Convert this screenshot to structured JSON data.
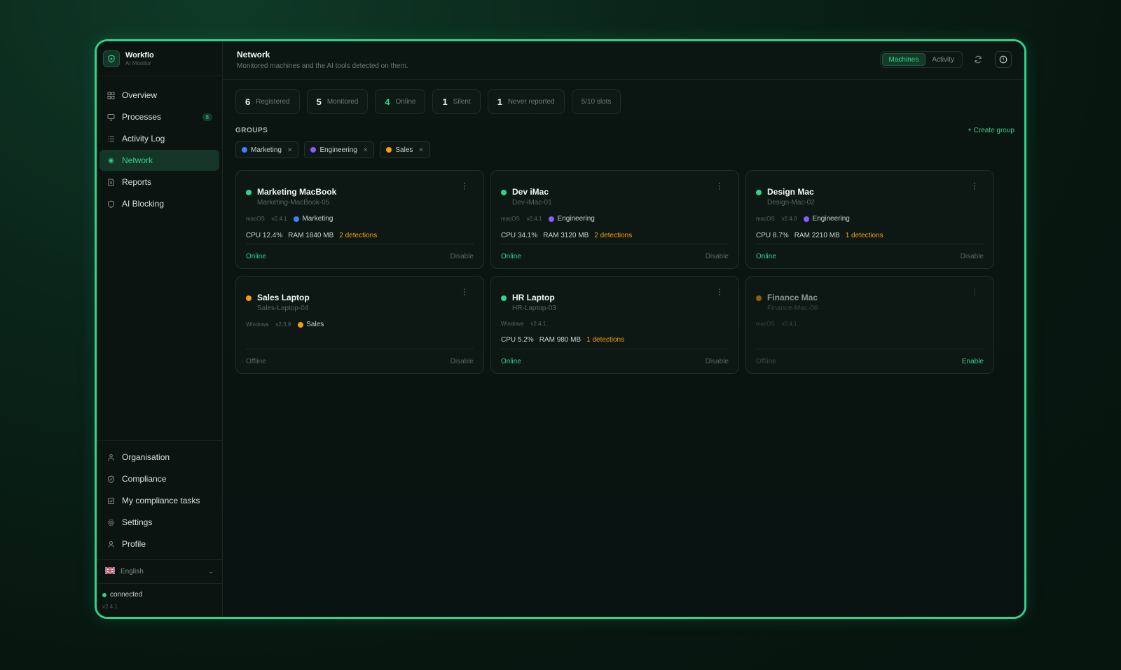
{
  "brand": {
    "name": "Workflo",
    "subtitle": "AI Monitor"
  },
  "sidebar": {
    "items": [
      {
        "label": "Overview",
        "icon": "grid-icon"
      },
      {
        "label": "Processes",
        "icon": "monitor-icon",
        "badge": "8"
      },
      {
        "label": "Activity Log",
        "icon": "list-icon"
      },
      {
        "label": "Network",
        "icon": "network-icon",
        "active": true
      },
      {
        "label": "Reports",
        "icon": "file-icon"
      },
      {
        "label": "AI Blocking",
        "icon": "shield-icon"
      }
    ],
    "bottom_items": [
      {
        "label": "Organisation",
        "icon": "org-icon"
      },
      {
        "label": "Compliance",
        "icon": "shield-check-icon"
      },
      {
        "label": "My compliance tasks",
        "icon": "tasks-icon"
      },
      {
        "label": "Settings",
        "icon": "gear-icon"
      },
      {
        "label": "Profile",
        "icon": "user-icon"
      }
    ],
    "language": "English",
    "connection": {
      "status": "connected",
      "version": "v2.4.1"
    }
  },
  "header": {
    "title": "Network",
    "subtitle": "Monitored machines and the AI tools detected on them.",
    "tabs": [
      "Machines",
      "Activity"
    ],
    "active_tab": "Machines"
  },
  "stats": [
    {
      "value": "6",
      "label": "Registered"
    },
    {
      "value": "5",
      "label": "Monitored"
    },
    {
      "value": "4",
      "label": "Online"
    },
    {
      "value": "1",
      "label": "Silent"
    },
    {
      "value": "1",
      "label": "Never reported"
    },
    {
      "value": "",
      "label": "5/10 slots"
    }
  ],
  "groups": {
    "label": "GROUPS",
    "create_label": "+ Create group",
    "chips": [
      {
        "label": "Marketing",
        "color": "#3b82f6"
      },
      {
        "label": "Engineering",
        "color": "#8b5cf6"
      },
      {
        "label": "Sales",
        "color": "#f59e0b"
      }
    ]
  },
  "colors": {
    "accent": "#2dd48a",
    "warning": "#f59e0b",
    "marketing": "#3b82f6",
    "engineering": "#8b5cf6",
    "sales": "#f59e0b"
  },
  "machines": [
    {
      "name": "Marketing MacBook",
      "host": "Marketing-MacBook-05",
      "os": "macOS",
      "version": "v2.4.1",
      "group": "Marketing",
      "group_color": "#3b82f6",
      "status_color": "#2dd48a",
      "cpu": "CPU 12.4%",
      "ram": "RAM 1840 MB",
      "detections": "2 detections",
      "status": "Online",
      "action": "Disable"
    },
    {
      "name": "Dev iMac",
      "host": "Dev-iMac-01",
      "os": "macOS",
      "version": "v2.4.1",
      "group": "Engineering",
      "group_color": "#8b5cf6",
      "status_color": "#2dd48a",
      "cpu": "CPU 34.1%",
      "ram": "RAM 3120 MB",
      "detections": "2 detections",
      "status": "Online",
      "action": "Disable"
    },
    {
      "name": "Design Mac",
      "host": "Design-Mac-02",
      "os": "macOS",
      "version": "v2.4.0",
      "group": "Engineering",
      "group_color": "#8b5cf6",
      "status_color": "#2dd48a",
      "cpu": "CPU 8.7%",
      "ram": "RAM 2210 MB",
      "detections": "1 detections",
      "status": "Online",
      "action": "Disable"
    },
    {
      "name": "Sales Laptop",
      "host": "Sales-Laptop-04",
      "os": "Windows",
      "version": "v2.3.9",
      "group": "Sales",
      "group_color": "#f59e0b",
      "status_color": "#f59e0b",
      "cpu": "",
      "ram": "",
      "detections": "",
      "status": "Offline",
      "action": "Disable"
    },
    {
      "name": "HR Laptop",
      "host": "HR-Laptop-03",
      "os": "Windows",
      "version": "v2.4.1",
      "group": "",
      "group_color": "",
      "status_color": "#2dd48a",
      "cpu": "CPU 5.2%",
      "ram": "RAM 980 MB",
      "detections": "1 detections",
      "status": "Online",
      "action": "Disable"
    },
    {
      "name": "Finance Mac",
      "host": "Finance-Mac-06",
      "os": "macOS",
      "version": "v2.4.1",
      "group": "",
      "group_color": "",
      "status_color": "#f59e0b",
      "cpu": "",
      "ram": "",
      "detections": "",
      "status": "Offline",
      "action": "Enable",
      "disabled": true
    }
  ]
}
